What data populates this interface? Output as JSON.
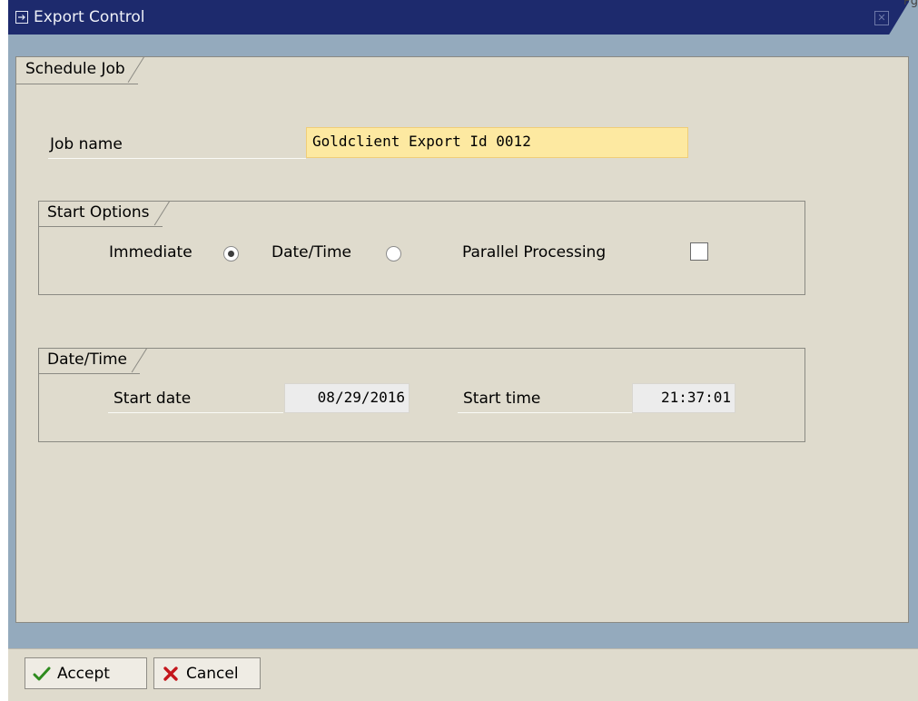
{
  "window": {
    "title": "Export Control",
    "corner_text": "Pg"
  },
  "tab": {
    "label": "Schedule Job"
  },
  "job": {
    "label": "Job name",
    "value": "Goldclient Export Id 0012"
  },
  "start_options": {
    "title": "Start Options",
    "immediate_label": "Immediate",
    "immediate_selected": true,
    "datetime_label": "Date/Time",
    "datetime_selected": false,
    "parallel_label": "Parallel Processing",
    "parallel_checked": false
  },
  "date_time": {
    "title": "Date/Time",
    "start_date_label": "Start date",
    "start_date_value": "08/29/2016",
    "start_time_label": "Start time",
    "start_time_value": "21:37:01"
  },
  "toolbar": {
    "accept_label": "Accept",
    "cancel_label": "Cancel"
  },
  "icons": {
    "window": "window-menu-icon",
    "close": "close-icon",
    "accept": "checkmark-icon",
    "cancel": "cross-icon"
  },
  "colors": {
    "title_bar": "#1d2a6d",
    "panel": "#dfdbcd",
    "required_input": "#fde9a1",
    "accept_icon": "#2e8b1e",
    "cancel_icon": "#c4161c"
  }
}
